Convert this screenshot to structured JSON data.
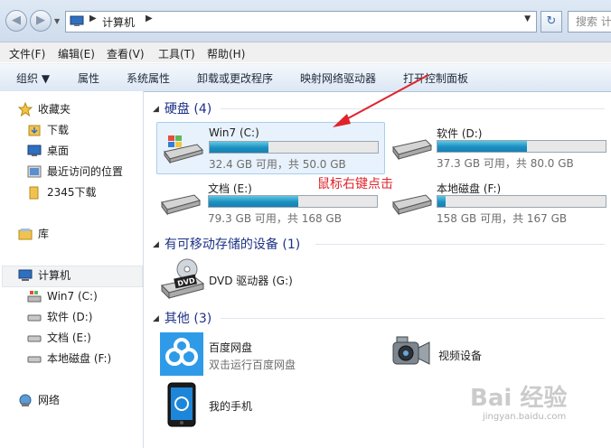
{
  "address_bar": {
    "back_icon": "back-arrow-icon",
    "forward_icon": "forward-arrow-icon",
    "path_label": "计算机",
    "search_placeholder": "搜索 计"
  },
  "menu": [
    "文件(F)",
    "编辑(E)",
    "查看(V)",
    "工具(T)",
    "帮助(H)"
  ],
  "toolbar": {
    "organize": "组织 ▼",
    "items": [
      "属性",
      "系统属性",
      "卸载或更改程序",
      "映射网络驱动器",
      "打开控制面板"
    ]
  },
  "nav": {
    "favorites": "收藏夹",
    "fav_items": [
      "下载",
      "桌面",
      "最近访问的位置",
      "2345下载"
    ],
    "library": "库",
    "computer": "计算机",
    "drives": [
      "Win7 (C:)",
      "软件 (D:)",
      "文档 (E:)",
      "本地磁盘 (F:)"
    ],
    "network": "网络"
  },
  "sections": {
    "hdd": "硬盘 (4)",
    "removable": "有可移动存储的设备 (1)",
    "other": "其他 (3)"
  },
  "drives": [
    {
      "name": "Win7 (C:)",
      "size": "32.4 GB 可用，共 50.0 GB",
      "used_fraction": 0.35
    },
    {
      "name": "软件 (D:)",
      "size": "37.3 GB 可用，共 80.0 GB",
      "used_fraction": 0.53
    },
    {
      "name": "文档 (E:)",
      "size": "79.3 GB 可用，共 168 GB",
      "used_fraction": 0.53
    },
    {
      "name": "本地磁盘 (F:)",
      "size": "158 GB 可用，共 167 GB",
      "used_fraction": 0.05
    }
  ],
  "dvd": {
    "name": "DVD 驱动器 (G:)",
    "label": "DVD"
  },
  "others": {
    "baidu_name": "百度网盘",
    "baidu_desc": "双击运行百度网盘",
    "video_name": "视频设备",
    "phone_name": "我的手机"
  },
  "annotation": "鼠标右键点击",
  "watermark": {
    "logo": "Bai 经验",
    "url": "jingyan.baidu.com"
  },
  "colors": {
    "accent": "#1e3287",
    "bar": "#1c8fc1",
    "annotation": "#e0232b"
  }
}
